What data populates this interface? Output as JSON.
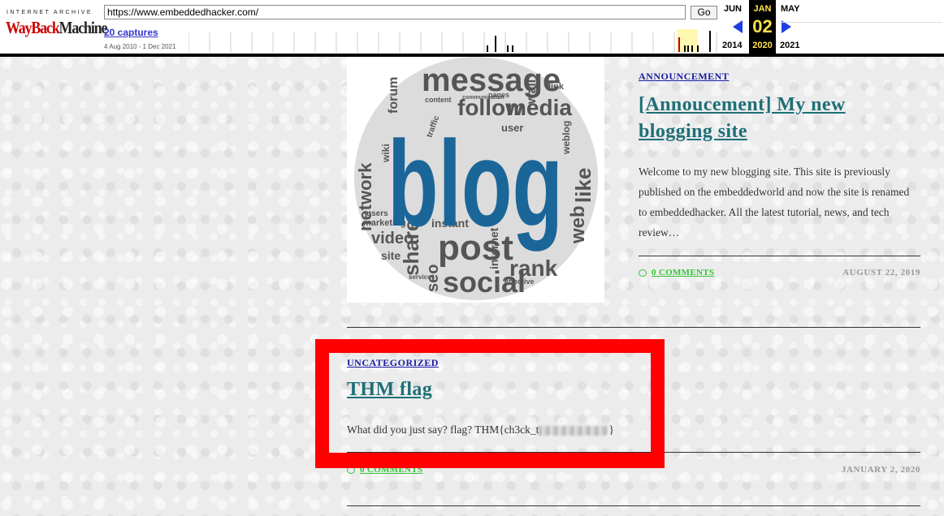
{
  "wayback": {
    "logo_top": "INTERNET ARCHIVE",
    "logo_way": "WayBack",
    "logo_machine": "Machine",
    "url": "https://www.embeddedhacker.com/",
    "go_label": "Go",
    "captures": "20 captures",
    "capture_range": "4 Aug 2010 - 1 Dec 2021",
    "prev_month": "JUN",
    "prev_year": "2014",
    "current_month": "JAN",
    "current_day": "02",
    "current_year": "2020",
    "next_month": "MAY",
    "next_year": "2021",
    "colors": {
      "arrow": "#1f3fe0",
      "current_text": "#ffe24a",
      "highlight": "#fff8b0"
    }
  },
  "posts": [
    {
      "category": "ANNOUNCEMENT",
      "title_line1": "[Annoucement] My new",
      "title_line2": "blogging site",
      "excerpt_lines": [
        "Welcome to my new blogging site. This site is previously",
        "published on the embeddedworld and now the site is renamed",
        "to embeddedhacker. All the latest tutorial, news, and tech",
        "review…"
      ],
      "comments": "0 COMMENTS",
      "date": "AUGUST 22, 2019",
      "image": {
        "main_word": "blog",
        "words": [
          "message",
          "forum",
          "wall",
          "link",
          "follow",
          "media",
          "network",
          "share",
          "post",
          "social",
          "rank",
          "web",
          "like",
          "video",
          "site",
          "seo",
          "marketing",
          "instant",
          "internet",
          "user",
          "weblog",
          "wiki",
          "effective",
          "services",
          "content",
          "traffic",
          "users",
          "pages",
          "communication"
        ]
      }
    },
    {
      "category": "UNCATEGORIZED",
      "title": "THM flag",
      "excerpt_visible": "What did you just say? flag? THM{ch3ck_t",
      "excerpt_end": "}",
      "comments": "0 COMMENTS",
      "date": "JANUARY 2, 2020"
    }
  ],
  "highlight_color": "#ff0000",
  "link_color": "#1e6f77",
  "comment_color": "#34c534"
}
